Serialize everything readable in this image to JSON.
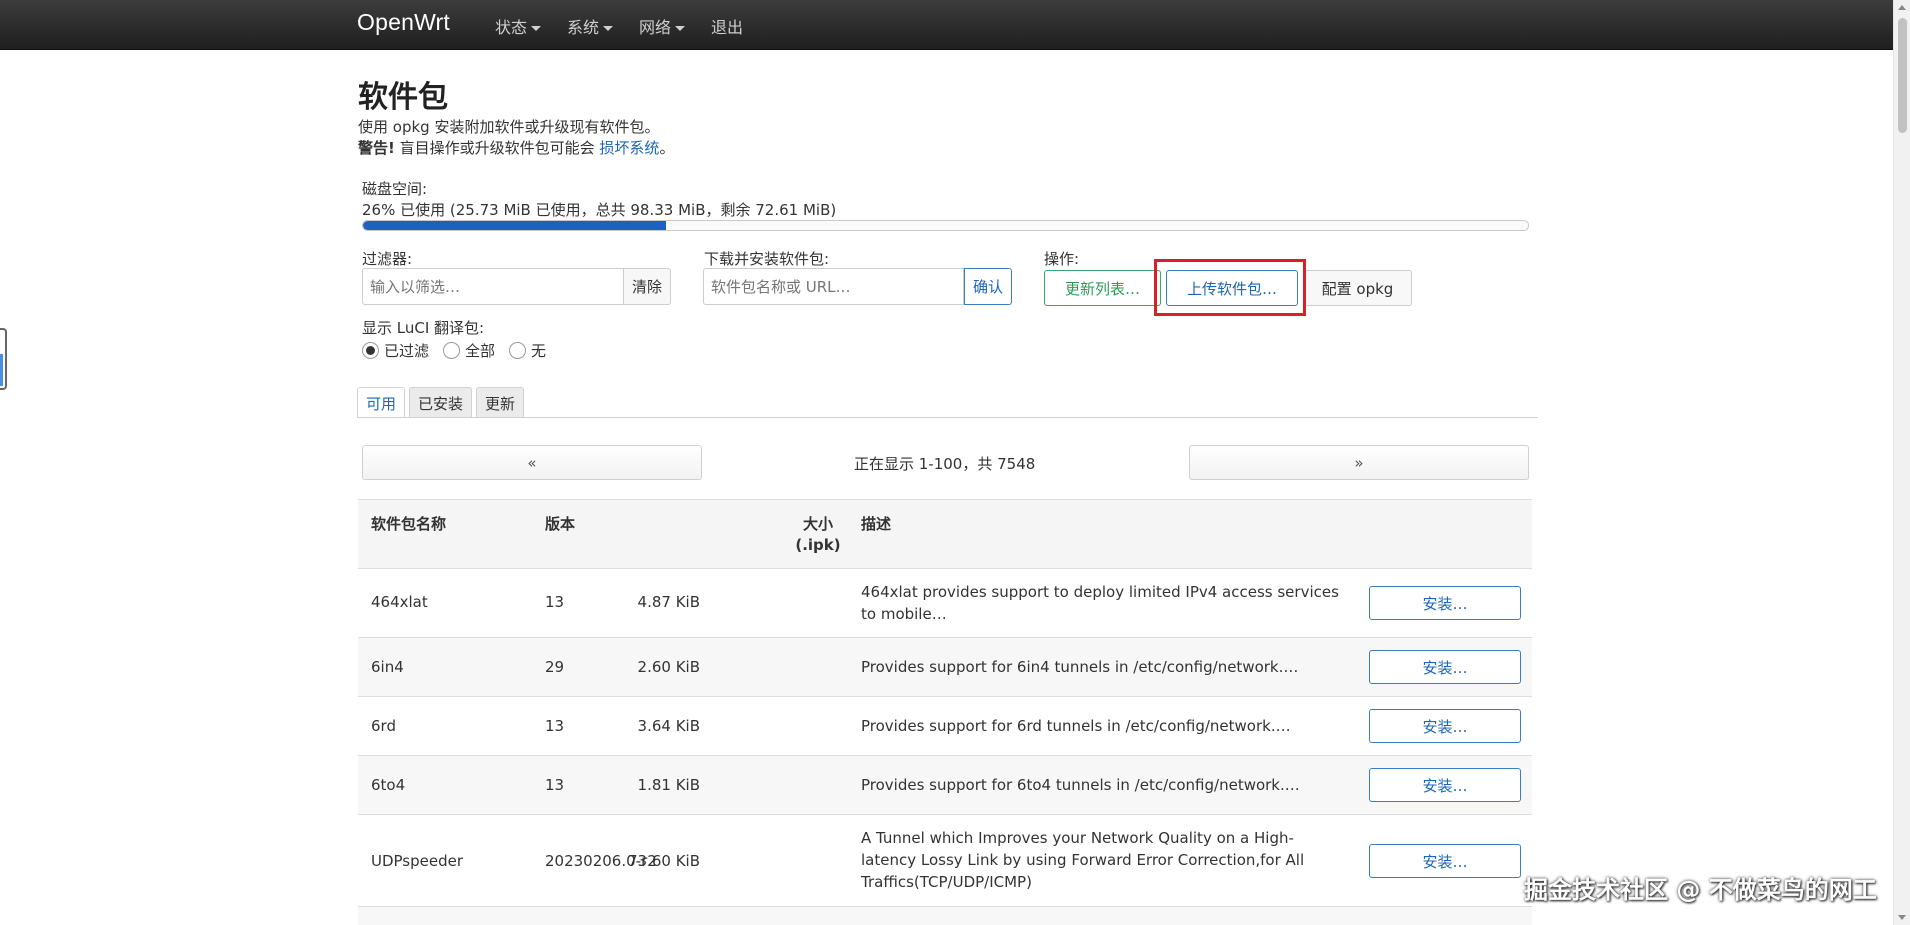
{
  "navbar": {
    "brand": "OpenWrt",
    "items": [
      "状态",
      "系统",
      "网络",
      "退出"
    ]
  },
  "page": {
    "title": "软件包",
    "description": "使用 opkg 安装附加软件或升级现有软件包。",
    "warning_bold": "警告!",
    "warning_text": "盲目操作或升级软件包可能会",
    "warning_link": "损坏系统",
    "warning_end": "。"
  },
  "disk": {
    "label": "磁盘空间:",
    "text": "26% 已使用 (25.73 MiB 已使用，总共 98.33 MiB，剩余 72.61 MiB)",
    "used_percent": 26
  },
  "filter": {
    "label": "过滤器:",
    "placeholder": "输入以筛选…",
    "clear_label": "清除"
  },
  "download": {
    "label": "下载并安装软件包:",
    "placeholder": "软件包名称或 URL…",
    "confirm_label": "确认"
  },
  "actions": {
    "label": "操作:",
    "update_list": "更新列表…",
    "upload_package": "上传软件包…",
    "configure_opkg": "配置 opkg"
  },
  "luci": {
    "label": "显示 LuCI 翻译包:",
    "options": [
      "已过滤",
      "全部",
      "无"
    ],
    "selected": "已过滤"
  },
  "tabs": [
    "可用",
    "已安装",
    "更新"
  ],
  "pager": {
    "prev": "«",
    "next": "»",
    "text": "正在显示 1-100，共 7548"
  },
  "table": {
    "headers": {
      "name": "软件包名称",
      "version": "版本",
      "size_line1": "大小",
      "size_line2": "(.ipk)",
      "desc": "描述"
    },
    "install_label": "安装…",
    "rows": [
      {
        "name": "464xlat",
        "version": "13",
        "size": "4.87 KiB",
        "desc": "464xlat provides support to deploy limited IPv4 access services to mobile…"
      },
      {
        "name": "6in4",
        "version": "29",
        "size": "2.60 KiB",
        "desc": "Provides support for 6in4 tunnels in /etc/config/network.…"
      },
      {
        "name": "6rd",
        "version": "13",
        "size": "3.64 KiB",
        "desc": "Provides support for 6rd tunnels in /etc/config/network.…"
      },
      {
        "name": "6to4",
        "version": "13",
        "size": "1.81 KiB",
        "desc": "Provides support for 6to4 tunnels in /etc/config/network.…"
      },
      {
        "name": "UDPspeeder",
        "version": "20230206.0-r2",
        "size": "73.60 KiB",
        "desc": "A Tunnel which Improves your Network Quality on a High-latency Lossy Link by using Forward Error Correction,for All Traffics(TCP/UDP/ICMP)"
      }
    ]
  },
  "watermark": "掘金技术社区 @ 不做菜鸟的网工"
}
